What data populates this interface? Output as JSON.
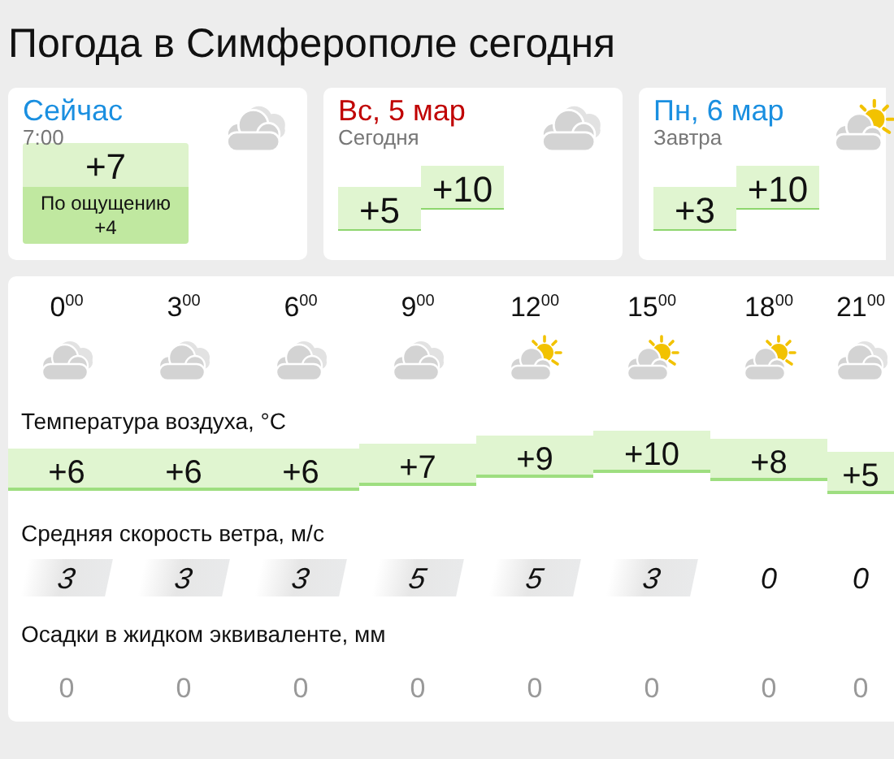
{
  "title": "Погода в Симферополе сегодня",
  "cards": [
    {
      "kind": "now",
      "heading": "Сейчас",
      "subheading": "7:00",
      "temp": "+7",
      "feels_label": "По ощущению",
      "feels": "+4"
    },
    {
      "kind": "day",
      "heading": "Вс, 5 мар",
      "subheading": "Сегодня",
      "min": "+5",
      "max": "+10"
    },
    {
      "kind": "day",
      "heading": "Пн, 6 мар",
      "subheading": "Завтра",
      "min": "+3",
      "max": "+10"
    }
  ],
  "hours": [
    {
      "kind": "cloudy",
      "time": "0$^{00}$",
      "temp": "+6",
      "wind": "3",
      "shaded": true,
      "precip": "0"
    },
    {
      "kind": "cloudy",
      "time": "3$^{00}$",
      "temp": "+6",
      "wind": "3",
      "shaded": true,
      "precip": "0"
    },
    {
      "kind": "cloudy",
      "time": "6$^{00}$",
      "temp": "+6",
      "wind": "3",
      "shaded": true,
      "precip": "0"
    },
    {
      "kind": "cloudy",
      "time": "9$^{00}$",
      "temp": "+7",
      "wind": "5",
      "shaded": true,
      "precip": "0"
    },
    {
      "kind": "sunny",
      "time": "12$^{00}$",
      "temp": "+9",
      "wind": "5",
      "shaded": true,
      "precip": "0"
    },
    {
      "kind": "sunny",
      "time": "15$^{00}$",
      "temp": "+10",
      "wind": "3",
      "shaded": true,
      "precip": "0"
    },
    {
      "kind": "sunny",
      "time": "18$^{00}$",
      "temp": "+8",
      "wind": "0",
      "shaded": false,
      "precip": "0"
    },
    {
      "kind": "cloudy",
      "time": "21$^{00}$",
      "temp": "+5",
      "wind": "0",
      "shaded": false,
      "precip": "0"
    }
  ],
  "labels": {
    "temperature": "Температура воздуха, °C",
    "wind": "Средняя скорость ветра, м/с",
    "precip": "Осадки в жидком эквиваленте, мм"
  }
}
